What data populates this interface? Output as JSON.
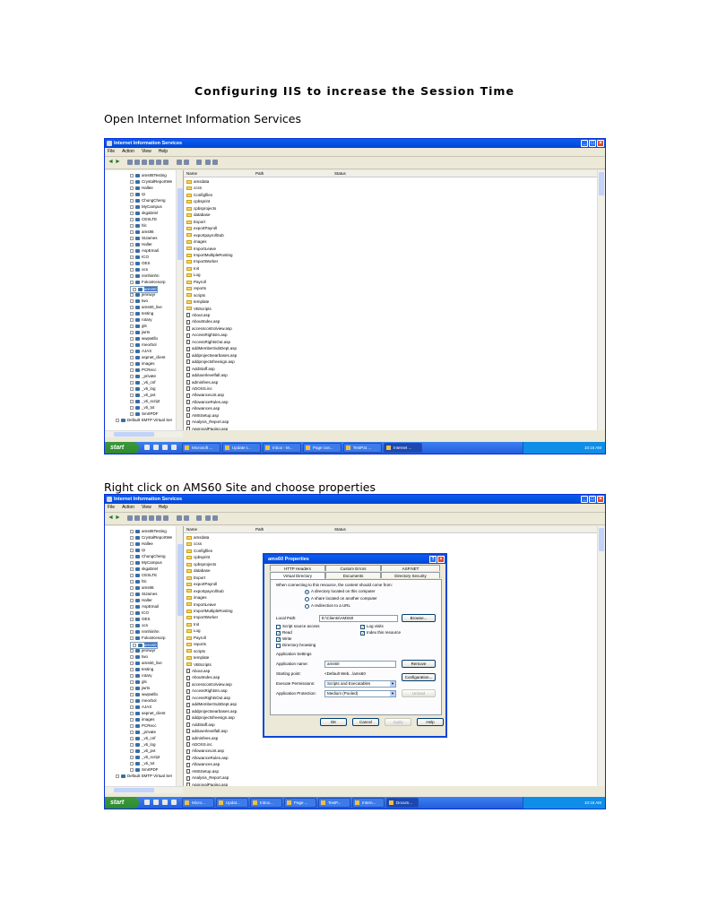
{
  "doc": {
    "title": "Configuring IIS to increase the Session Time",
    "step1": "Open Internet Information Services",
    "step2": "Right click on AMS60 Site and choose properties"
  },
  "window": {
    "title": "Internet Information Services",
    "menu": [
      "File",
      "Action",
      "View",
      "Help"
    ],
    "columns": {
      "name": "Name",
      "path": "Path",
      "status": "Status"
    }
  },
  "tree": [
    "ams85Testing",
    "CrystalReportWe",
    "Hallee",
    "rp",
    "ChungCheng",
    "MyCampus",
    "skgabriel",
    "CESLTE",
    "hlc",
    "ams86",
    "StJames",
    "Haller",
    "AspEmail",
    "ICO",
    "OES",
    "ocs",
    "nnnhiinhn",
    "FokosKesorp",
    "ams60",
    "jennwyr",
    "two",
    "ams60_live",
    "testing",
    "rotary",
    "gls",
    "jwrts",
    "wwpwtllo",
    "rneorbol",
    "AJAX",
    "aspnet_client",
    "images",
    "PCRecc",
    "_private",
    "_vti_cnf",
    "_vti_log",
    "_vti_pvt",
    "_vti_script",
    "_vti_txt",
    "SmrtPDF",
    "Default SMTP Virtual Ser"
  ],
  "tree_selected": "ams60",
  "list": [
    {
      "name": "amsdata",
      "type": "folder"
    },
    {
      "name": "ccss",
      "type": "folder"
    },
    {
      "name": "Configfiles",
      "type": "folder"
    },
    {
      "name": "cpbsprint",
      "type": "folder"
    },
    {
      "name": "cpbsprojects",
      "type": "folder"
    },
    {
      "name": "database",
      "type": "folder"
    },
    {
      "name": "Export",
      "type": "folder"
    },
    {
      "name": "exportPayroll",
      "type": "folder"
    },
    {
      "name": "exportpayrollSub",
      "type": "folder"
    },
    {
      "name": "images",
      "type": "folder"
    },
    {
      "name": "ImportLeave",
      "type": "folder"
    },
    {
      "name": "ImportMultipleRosting",
      "type": "folder"
    },
    {
      "name": "ImportWorker",
      "type": "folder"
    },
    {
      "name": "Init",
      "type": "folder"
    },
    {
      "name": "Log",
      "type": "folder"
    },
    {
      "name": "Payroll",
      "type": "folder"
    },
    {
      "name": "reports",
      "type": "folder"
    },
    {
      "name": "scripts",
      "type": "folder"
    },
    {
      "name": "template",
      "type": "folder"
    },
    {
      "name": "VBScripts",
      "type": "folder"
    },
    {
      "name": "About.asp",
      "type": "file"
    },
    {
      "name": "AboutIndex.asp",
      "type": "file"
    },
    {
      "name": "accesscontrolview.asp",
      "type": "file"
    },
    {
      "name": "AccessRightsIn.asp",
      "type": "file"
    },
    {
      "name": "AccessRightsOut.asp",
      "type": "file"
    },
    {
      "name": "addMemberSubDept.asp",
      "type": "file"
    },
    {
      "name": "addprojectsearbases.asp",
      "type": "file"
    },
    {
      "name": "addprojectsfreesign.asp",
      "type": "file"
    },
    {
      "name": "AddStaff.asp",
      "type": "file"
    },
    {
      "name": "adduserlevelfall.asp",
      "type": "file"
    },
    {
      "name": "adminfees.asp",
      "type": "file"
    },
    {
      "name": "ADOSS.inc",
      "type": "file"
    },
    {
      "name": "AllowanceList.asp",
      "type": "file"
    },
    {
      "name": "AllowanceRules.asp",
      "type": "file"
    },
    {
      "name": "Allowances.asp",
      "type": "file"
    },
    {
      "name": "AMSSetup.asp",
      "type": "file"
    },
    {
      "name": "Analysis_Report.asp",
      "type": "file"
    },
    {
      "name": "ApprovalPaging.asp",
      "type": "file"
    }
  ],
  "taskbar": {
    "start": "start",
    "shot1_tasks": [
      "Microsoft ...",
      "Update t...",
      "Inbox - M...",
      "Page con...",
      "TestPat ...",
      "Internet ..."
    ],
    "shot2_tasks": [
      "Micro...",
      "Updat...",
      "Inbox...",
      "Page ...",
      "TestP...",
      "Intern...",
      "Docum..."
    ],
    "clock": "10:15 AM"
  },
  "dialog": {
    "title": "ams60 Properties",
    "tabs_row1": [
      "HTTP Headers",
      "Custom Errors",
      "ASP.NET"
    ],
    "tabs_row2": [
      "Virtual Directory",
      "Documents",
      "Directory Security"
    ],
    "prompt": "When connecting to this resource, the content should come from:",
    "radio": [
      "A directory located on this computer",
      "A share located on another computer",
      "A redirection to a URL"
    ],
    "local_path_label": "Local Path:",
    "local_path_value": "E:\\Clients\\AMS60",
    "browse": "Browse...",
    "checks_left": [
      "Script source access",
      "Read",
      "Write",
      "Directory browsing"
    ],
    "checks_right": [
      "Log visits",
      "Index this resource"
    ],
    "app_settings": "Application Settings",
    "app_name_label": "Application name:",
    "app_name_value": "ams60",
    "remove": "Remove",
    "start_point_label": "Starting point:",
    "start_point_value": "<Default Web...\\ams60",
    "configuration": "Configuration...",
    "exec_label": "Execute Permissions:",
    "exec_value": "Scripts and Executables",
    "protect_label": "Application Protection:",
    "protect_value": "Medium (Pooled)",
    "unload": "Unload",
    "ok": "OK",
    "cancel": "Cancel",
    "apply": "Apply",
    "help": "Help"
  }
}
